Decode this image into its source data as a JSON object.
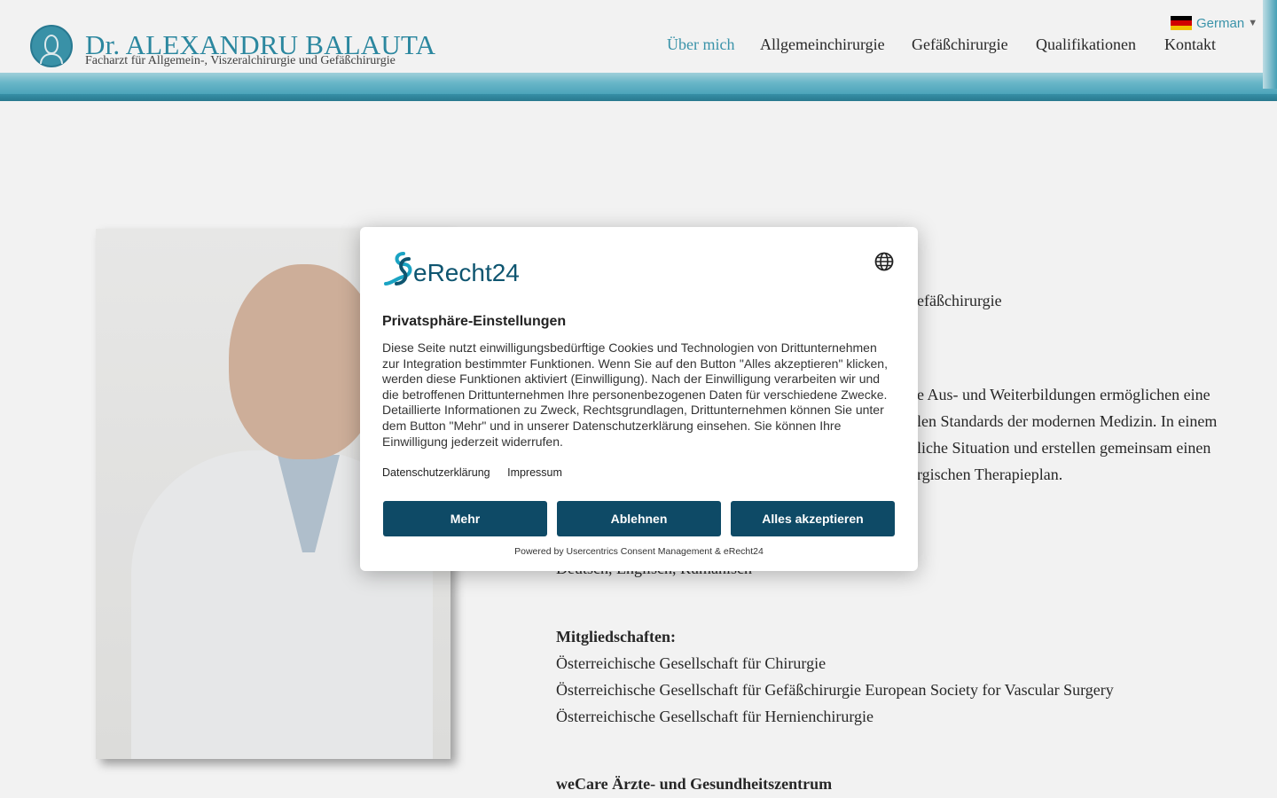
{
  "header": {
    "brand_title": "Dr. ALEXANDRU BALAUTA",
    "brand_subtitle": "Facharzt für Allgemein-, Viszeralchirurgie und Gefäßchirurgie",
    "nav": [
      {
        "label": "Über mich",
        "active": true
      },
      {
        "label": "Allgemeinchirurgie",
        "active": false
      },
      {
        "label": "Gefäßchirurgie",
        "active": false
      },
      {
        "label": "Qualifikationen",
        "active": false
      },
      {
        "label": "Kontakt",
        "active": false
      }
    ],
    "language": "German"
  },
  "content": {
    "line_specialty_tail": "efäßchirurgie",
    "intro_lines": [
      "e Aus- und Weiterbildungen ermöglichen eine",
      "len Standards der modernen Medizin. In einem",
      "liche Situation und erstellen gemeinsam einen",
      "rgischen Therapieplan."
    ],
    "languages_line": "Deutsch, Englisch, Rumänisch",
    "memberships_heading": "Mitgliedschaften:",
    "memberships": [
      "Österreichische Gesellschaft für Chirurgie",
      "Österreichische Gesellschaft für Gefäßchirurgie European Society for Vascular Surgery",
      "Österreichische Gesellschaft für Hernienchirurgie"
    ],
    "wecare_heading": "weCare Ärzte- und Gesundheitszentrum"
  },
  "consent": {
    "logo_text": "eRecht24",
    "title": "Privatsphäre-Einstellungen",
    "body": "Diese Seite nutzt einwilligungsbedürftige Cookies und Technologien von Drittunternehmen zur Integration bestimmter Funktionen. Wenn Sie auf den Button \"Alles akzeptieren\" klicken, werden diese Funktionen aktiviert (Einwilligung). Nach der Einwilligung verarbeiten wir und die betroffenen Drittunternehmen Ihre personenbezogenen Daten für verschiedene Zwecke. Detaillierte Informationen zu Zweck, Rechtsgrundlagen, Drittunternehmen können Sie unter dem Button \"Mehr\" und in unserer Datenschutzerklärung einsehen. Sie können Ihre Einwilligung jederzeit widerrufen.",
    "link_privacy": "Datenschutzerklärung",
    "link_imprint": "Impressum",
    "btn_more": "Mehr",
    "btn_decline": "Ablehnen",
    "btn_accept": "Alles akzeptieren",
    "powered_by": "Powered by Usercentrics Consent Management & eRecht24"
  },
  "colors": {
    "accent": "#3e9bb3",
    "button": "#0e4a66"
  }
}
